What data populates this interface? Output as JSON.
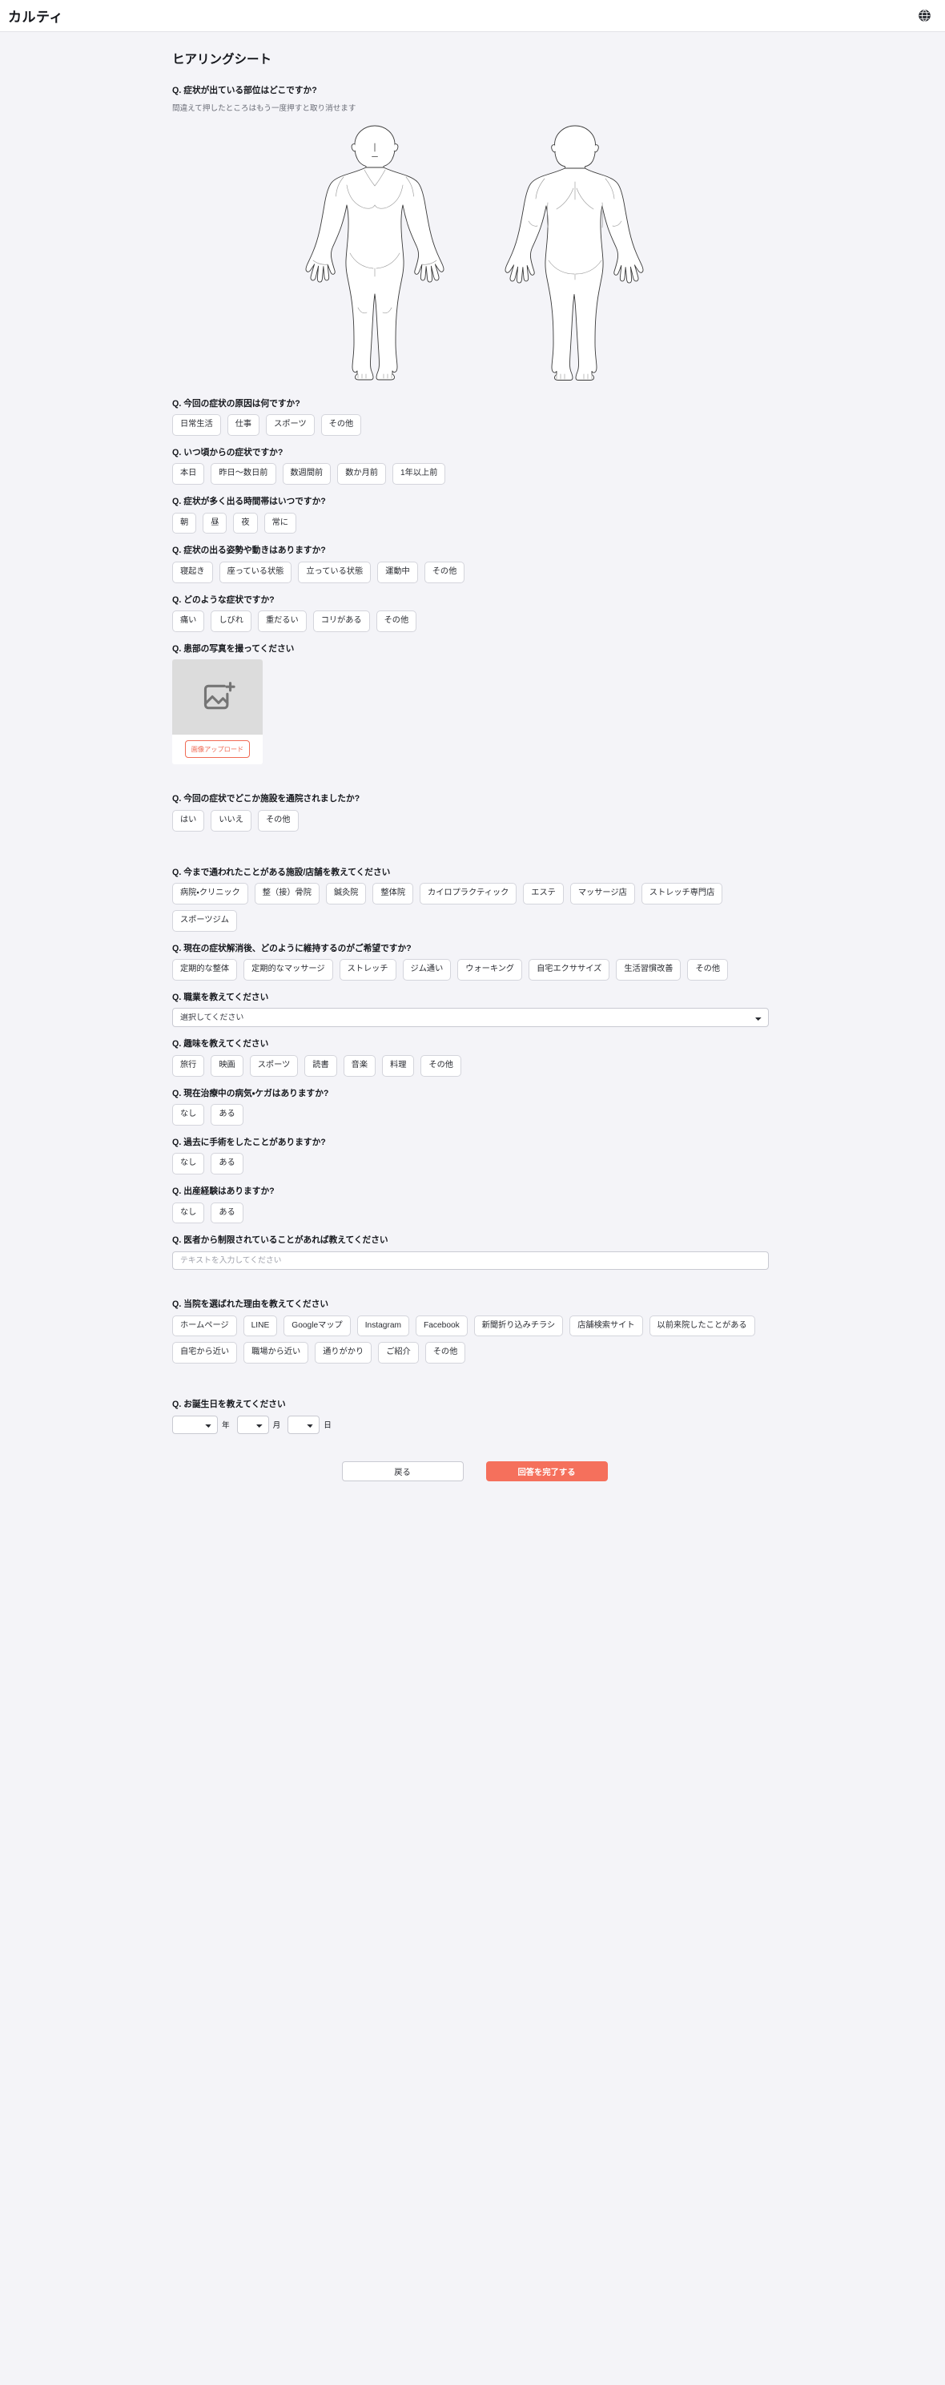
{
  "app": {
    "brand": "カルティ",
    "globe_icon": "globe-icon"
  },
  "page": {
    "title": "ヒアリングシート"
  },
  "colors": {
    "page_bg": "#f4f4f8",
    "appbar_bg": "#ffffff",
    "chip_bg": "#ffffff",
    "chip_border": "#d4d5dc",
    "accent_orange": "#f5705c",
    "upload_btn_border": "#f06b55",
    "text_primary": "#16181d",
    "text_muted": "#6b6e78"
  },
  "questions": {
    "body_part": {
      "label": "Q. 症状が出ている部位はどこですか?",
      "sub": "間違えて押したところはもう一度押すと取り消せます",
      "front_map_name": "body-map-front",
      "back_map_name": "body-map-back"
    },
    "cause": {
      "label": "Q. 今回の症状の原因は何ですか?",
      "options": [
        "日常生活",
        "仕事",
        "スポーツ",
        "その他"
      ]
    },
    "onset": {
      "label": "Q. いつ頃からの症状ですか?",
      "options": [
        "本日",
        "昨日〜数日前",
        "数週間前",
        "数か月前",
        "1年以上前"
      ]
    },
    "time_of_day": {
      "label": "Q. 症状が多く出る時間帯はいつですか?",
      "options": [
        "朝",
        "昼",
        "夜",
        "常に"
      ]
    },
    "posture": {
      "label": "Q. 症状の出る姿勢や動きはありますか?",
      "options": [
        "寝起き",
        "座っている状態",
        "立っている状態",
        "運動中",
        "その他"
      ]
    },
    "symptom_type": {
      "label": "Q. どのような症状ですか?",
      "options": [
        "痛い",
        "しびれ",
        "重だるい",
        "コリがある",
        "その他"
      ]
    },
    "photo": {
      "label": "Q. 患部の写真を撮ってください",
      "upload_button": "画像アップロード",
      "placeholder_icon": "add-image-icon"
    },
    "visited_facility": {
      "label": "Q. 今回の症状でどこか施設を通院されましたか?",
      "options": [
        "はい",
        "いいえ",
        "その他"
      ]
    },
    "past_facilities": {
      "label": "Q. 今まで通われたことがある施設/店舗を教えてください",
      "options": [
        "病院・クリニック",
        "整（接）骨院",
        "鍼灸院",
        "整体院",
        "カイロプラクティック",
        "エステ",
        "マッサージ店",
        "ストレッチ専門店",
        "スポーツジム"
      ]
    },
    "maintenance": {
      "label": "Q. 現在の症状解消後、どのように維持するのがご希望ですか?",
      "options": [
        "定期的な整体",
        "定期的なマッサージ",
        "ストレッチ",
        "ジム通い",
        "ウォーキング",
        "自宅エクササイズ",
        "生活習慣改善",
        "その他"
      ]
    },
    "occupation": {
      "label": "Q. 職業を教えてください",
      "selected": "選択してください"
    },
    "hobby": {
      "label": "Q. 趣味を教えてください",
      "options": [
        "旅行",
        "映画",
        "スポーツ",
        "読書",
        "音楽",
        "料理",
        "その他"
      ]
    },
    "current_illness": {
      "label": "Q. 現在治療中の病気・ケガはありますか?",
      "options": [
        "なし",
        "ある"
      ]
    },
    "past_surgery": {
      "label": "Q. 過去に手術をしたことがありますか?",
      "options": [
        "なし",
        "ある"
      ]
    },
    "childbirth": {
      "label": "Q. 出産経験はありますか?",
      "options": [
        "なし",
        "ある"
      ]
    },
    "doctor_restrictions": {
      "label": "Q. 医者から制限されていることがあれば教えてください",
      "placeholder": "テキストを入力してください",
      "value": ""
    },
    "referral": {
      "label": "Q. 当院を選ばれた理由を教えてください",
      "options": [
        "ホームページ",
        "LINE",
        "Googleマップ",
        "Instagram",
        "Facebook",
        "新聞折り込みチラシ",
        "店舗検索サイト",
        "以前来院したことがある",
        "自宅から近い",
        "職場から近い",
        "通りがかり",
        "ご紹介",
        "その他"
      ]
    },
    "birthday": {
      "label": "Q. お誕生日を教えてください",
      "year_value": "",
      "year_unit": "年",
      "month_value": "",
      "month_unit": "月",
      "day_value": "",
      "day_unit": "日"
    }
  },
  "footer": {
    "back_label": "戻る",
    "submit_label": "回答を完了する"
  }
}
